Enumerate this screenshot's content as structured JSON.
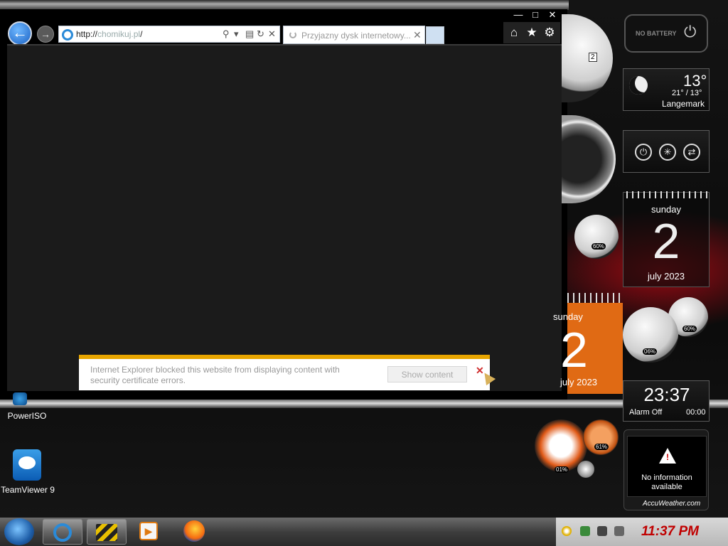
{
  "browser": {
    "window_buttons": {
      "minimize": "—",
      "maximize": "□",
      "close": "✕"
    },
    "back_symbol": "←",
    "forward_symbol": "→",
    "address": {
      "prefix": "http://",
      "domain": "chomikuj.pl",
      "suffix": "/"
    },
    "tab": {
      "title": "Przyjazny dysk internetowy...",
      "close": "✕"
    },
    "command_icons": {
      "home": "⌂",
      "favorites": "★",
      "tools": "⚙"
    },
    "address_icons": {
      "search": "⚲",
      "dropdown": "▾",
      "compat": "▤",
      "refresh": "↻",
      "stop": "✕"
    }
  },
  "notification": {
    "message": "Internet Explorer blocked this website from displaying content with security certificate errors.",
    "button": "Show content",
    "close": "✕",
    "accent_color": "#e8a600"
  },
  "desktop_icons": [
    {
      "label": "PowerISO"
    },
    {
      "label": "TeamViewer 9"
    }
  ],
  "gadgets": {
    "battery": {
      "text": "NO BATTERY",
      "plug": "⏻"
    },
    "weather": {
      "temp": "13°",
      "range": "21° / 13°",
      "city": "Langemark"
    },
    "calendar": {
      "day": "sunday",
      "date": "2",
      "month": "july 2023"
    },
    "calendar_orange": {
      "day": "sunday",
      "date": "2",
      "month": "july 2023"
    },
    "clock": {
      "time": "23:37",
      "alarm_label": "Alarm Off",
      "alarm_time": "00:00"
    },
    "gauges": {
      "gauge_a": "60%",
      "gauge_b": "60%",
      "gauge_c": "06%",
      "gauge_d": "01%",
      "gauge_e": "61%",
      "clock_small_num": "2"
    },
    "accuweather": {
      "message": "No information available",
      "brand": "AccuWeather.com",
      "warn": "!"
    },
    "power_icons": {
      "power": "⏻",
      "brightness": "✳",
      "switch": "⇄"
    }
  },
  "taskbar": {
    "media_icon": "▶",
    "tray_time": "11:37 PM"
  }
}
